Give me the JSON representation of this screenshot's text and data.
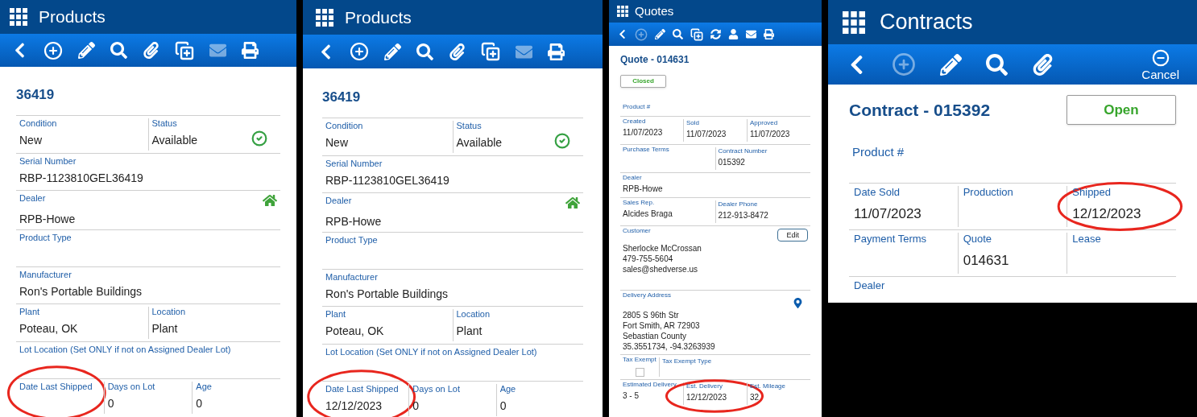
{
  "panels": [
    {
      "app_title": "Products",
      "toolbar": [
        {
          "kind": "back",
          "disabled": false
        },
        {
          "kind": "add",
          "disabled": false
        },
        {
          "kind": "edit",
          "disabled": false
        },
        {
          "kind": "search",
          "disabled": false
        },
        {
          "kind": "attach",
          "disabled": false
        },
        {
          "kind": "copy",
          "disabled": false
        },
        {
          "kind": "mail",
          "disabled": true
        },
        {
          "kind": "print",
          "disabled": false
        }
      ],
      "record": {
        "title": "36419"
      },
      "rows": [
        [
          {
            "kind": "text",
            "label": "Condition",
            "lines": [
              "New"
            ]
          },
          {
            "kind": "check",
            "label": "Status",
            "lines": [
              "Available"
            ]
          }
        ],
        [
          {
            "kind": "text",
            "label": "Serial Number",
            "lines": [
              "RBP-1123810GEL36419"
            ]
          }
        ],
        [
          {
            "kind": "home",
            "label": "Dealer",
            "lines": [
              "RPB-Howe"
            ]
          }
        ],
        [
          {
            "kind": "text",
            "label": "Product Type"
          }
        ],
        [
          {
            "kind": "text",
            "label": "Manufacturer",
            "lines": [
              "Ron's Portable Buildings"
            ]
          }
        ],
        [
          {
            "kind": "text",
            "label": "Plant",
            "lines": [
              "Poteau, OK"
            ]
          },
          {
            "kind": "text",
            "label": "Location",
            "lines": [
              "Plant"
            ]
          }
        ],
        [
          {
            "kind": "text",
            "label": "Lot Location (Set ONLY if not on Assigned Dealer Lot)"
          }
        ],
        [
          {
            "kind": "text",
            "label": "Date Last Shipped",
            "circled": true
          },
          {
            "kind": "text",
            "label": "Days on Lot",
            "lines": [
              "0"
            ]
          },
          {
            "kind": "text",
            "label": "Age",
            "lines": [
              "0"
            ]
          }
        ]
      ]
    },
    {
      "app_title": "Products",
      "toolbar": [
        {
          "kind": "back",
          "disabled": false
        },
        {
          "kind": "add",
          "disabled": false
        },
        {
          "kind": "edit",
          "disabled": false
        },
        {
          "kind": "search",
          "disabled": false
        },
        {
          "kind": "attach",
          "disabled": false
        },
        {
          "kind": "copy",
          "disabled": false
        },
        {
          "kind": "mail",
          "disabled": true
        },
        {
          "kind": "print",
          "disabled": false
        }
      ],
      "record": {
        "title": "36419"
      },
      "rows": [
        [
          {
            "kind": "text",
            "label": "Condition",
            "lines": [
              "New"
            ]
          },
          {
            "kind": "check",
            "label": "Status",
            "lines": [
              "Available"
            ]
          }
        ],
        [
          {
            "kind": "text",
            "label": "Serial Number",
            "lines": [
              "RBP-1123810GEL36419"
            ]
          }
        ],
        [
          {
            "kind": "home",
            "label": "Dealer",
            "lines": [
              "RPB-Howe"
            ]
          }
        ],
        [
          {
            "kind": "text",
            "label": "Product Type"
          }
        ],
        [
          {
            "kind": "text",
            "label": "Manufacturer",
            "lines": [
              "Ron's Portable Buildings"
            ]
          }
        ],
        [
          {
            "kind": "text",
            "label": "Plant",
            "lines": [
              "Poteau, OK"
            ]
          },
          {
            "kind": "text",
            "label": "Location",
            "lines": [
              "Plant"
            ]
          }
        ],
        [
          {
            "kind": "text",
            "label": "Lot Location (Set ONLY if not on Assigned Dealer Lot)"
          }
        ],
        [
          {
            "kind": "text",
            "label": "Date Last Shipped",
            "lines": [
              "12/12/2023"
            ],
            "circled": true
          },
          {
            "kind": "text",
            "label": "Days on Lot",
            "lines": [
              "0"
            ]
          },
          {
            "kind": "text",
            "label": "Age",
            "lines": [
              "0"
            ]
          }
        ]
      ]
    },
    {
      "app_title": "Quotes",
      "toolbar": [
        {
          "kind": "back",
          "disabled": false
        },
        {
          "kind": "add",
          "disabled": true
        },
        {
          "kind": "edit",
          "disabled": false
        },
        {
          "kind": "search",
          "disabled": false
        },
        {
          "kind": "copy",
          "disabled": false
        },
        {
          "kind": "refresh",
          "disabled": false
        },
        {
          "kind": "person",
          "disabled": false
        },
        {
          "kind": "mail",
          "disabled": false
        },
        {
          "kind": "print",
          "disabled": false
        }
      ],
      "record": {
        "title": "Quote - 014631",
        "status": "Closed",
        "field_label": "Product #"
      },
      "rows": [
        [
          {
            "kind": "text",
            "label": "Created",
            "lines": [
              "11/07/2023"
            ]
          },
          {
            "kind": "text",
            "label": "Sold",
            "lines": [
              "11/07/2023"
            ]
          },
          {
            "kind": "text",
            "label": "Approved",
            "lines": [
              "11/07/2023"
            ]
          }
        ],
        [
          {
            "kind": "text",
            "label": "Purchase Terms"
          },
          {
            "kind": "text",
            "label": "Contract Number",
            "lines": [
              "015392"
            ]
          }
        ],
        [
          {
            "kind": "text",
            "label": "Dealer",
            "lines": [
              "RPB-Howe"
            ]
          }
        ],
        [
          {
            "kind": "text",
            "label": "Sales Rep.",
            "lines": [
              "Alcides Braga"
            ]
          },
          {
            "kind": "text",
            "label": "Dealer Phone",
            "lines": [
              "212-913-8472"
            ]
          }
        ],
        [
          {
            "kind": "contact",
            "label": "Customer",
            "lines": [
              "Sherlocke McCrossan",
              "479-755-5604",
              "sales@shedverse.us"
            ],
            "action": "Edit"
          }
        ],
        [
          {
            "kind": "location",
            "label": "Delivery Address",
            "lines": [
              "2805 S 96th Str",
              "Fort Smith, AR 72903",
              "Sebastian County",
              "35.3551734, -94.3263939"
            ]
          }
        ],
        [
          {
            "kind": "checkbox",
            "label": "Tax Exempt",
            "checked": false
          },
          {
            "kind": "text",
            "label": "Tax Exempt Type"
          }
        ],
        [
          {
            "kind": "text",
            "label": "Estimated Delivery",
            "lines": [
              "3 - 5"
            ]
          },
          {
            "kind": "text",
            "label": "Est. Delivery",
            "lines": [
              "12/12/2023"
            ],
            "circled": true
          },
          {
            "kind": "text",
            "label": "Est. Mileage",
            "lines": [
              "32"
            ]
          }
        ]
      ]
    },
    {
      "app_title": "Contracts",
      "toolbar": [
        {
          "kind": "back",
          "disabled": false
        },
        {
          "kind": "add",
          "disabled": true
        },
        {
          "kind": "edit",
          "disabled": false
        },
        {
          "kind": "search",
          "disabled": false
        },
        {
          "kind": "attach",
          "disabled": false
        },
        {
          "kind": "cancel",
          "disabled": false,
          "label": "Cancel"
        }
      ],
      "record": {
        "title": "Contract - 015392",
        "status": "Open",
        "field_label": "Product #"
      },
      "rows": [
        [
          {
            "kind": "text",
            "label": "Date Sold",
            "lines": [
              "11/07/2023"
            ]
          },
          {
            "kind": "text",
            "label": "Production"
          },
          {
            "kind": "text",
            "label": "Shipped",
            "lines": [
              "12/12/2023"
            ],
            "circled": true
          }
        ],
        [
          {
            "kind": "text",
            "label": "Payment Terms"
          },
          {
            "kind": "text",
            "label": "Quote",
            "lines": [
              "014631"
            ]
          },
          {
            "kind": "text",
            "label": "Lease"
          }
        ],
        [
          {
            "kind": "text",
            "label": "Dealer"
          }
        ]
      ]
    }
  ]
}
